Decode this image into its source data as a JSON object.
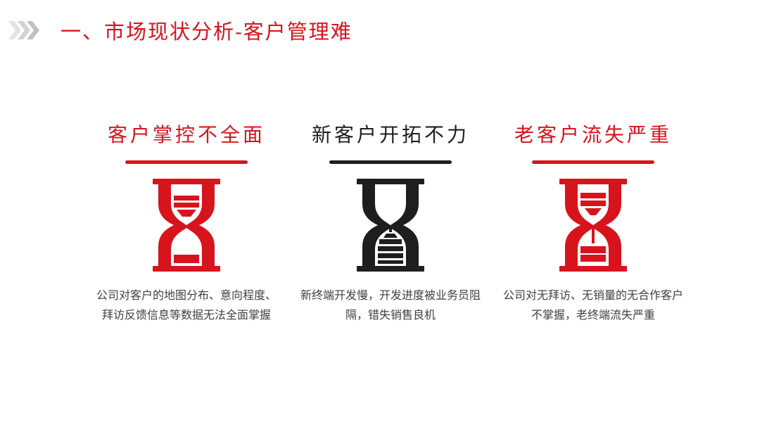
{
  "header": {
    "title": "一、市场现状分析-客户管理难"
  },
  "colors": {
    "accent_red": "#d7141c",
    "dark": "#1e1e1e",
    "text_gray": "#404040"
  },
  "columns": [
    {
      "title": "客户掌控不全面",
      "description": "公司对客户的地图分布、意向程度、拜访反馈信息等数据无法全面掌握",
      "color": "#d7141c",
      "icon": "hourglass-icon"
    },
    {
      "title": "新客户开拓不力",
      "description": "新终端开发慢，开发进度被业务员阻隔，错失销售良机",
      "color": "#1e1e1e",
      "icon": "hourglass-icon"
    },
    {
      "title": "老客户流失严重",
      "description": "公司对无拜访、无销量的无合作客户不掌握，老终端流失严重",
      "color": "#d7141c",
      "icon": "hourglass-icon"
    }
  ]
}
